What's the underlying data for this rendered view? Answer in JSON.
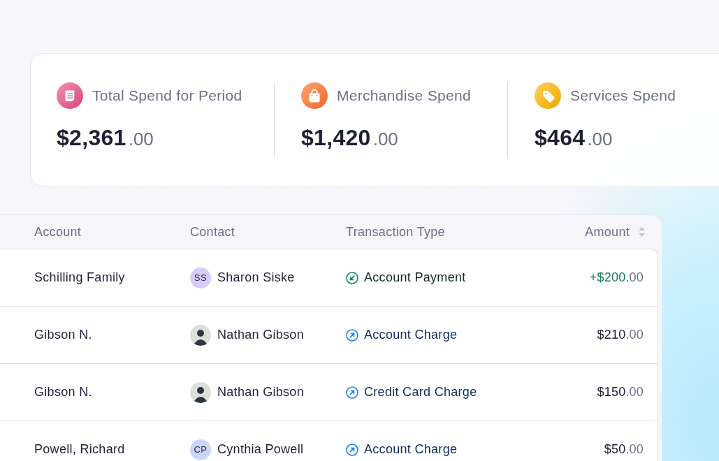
{
  "summary": {
    "stats": [
      {
        "kind": "receipt",
        "label": "Total Spend for Period",
        "amount": "$2,361",
        "cents": ".00"
      },
      {
        "kind": "bag",
        "label": "Merchandise Spend",
        "amount": "$1,420",
        "cents": ".00"
      },
      {
        "kind": "tag",
        "label": "Services Spend",
        "amount": "$464",
        "cents": ".00"
      }
    ]
  },
  "table": {
    "columns": [
      {
        "label": "Account",
        "sortable": false
      },
      {
        "label": "Contact",
        "sortable": false
      },
      {
        "label": "Transaction Type",
        "sortable": false
      },
      {
        "label": "Amount",
        "sortable": true
      }
    ],
    "rows": [
      {
        "account": "Schilling Family",
        "contact": {
          "name": "Sharon Siske",
          "avatar": {
            "kind": "initials",
            "initials": "SS",
            "color": "#d8cbfa"
          }
        },
        "type": {
          "kind": "payment",
          "label": "Account Payment"
        },
        "amount": {
          "whole": "+$200",
          "cents": ".00"
        }
      },
      {
        "account": "Gibson N.",
        "contact": {
          "name": "Nathan Gibson",
          "avatar": {
            "kind": "photo"
          }
        },
        "type": {
          "kind": "charge",
          "label": "Account Charge"
        },
        "amount": {
          "whole": "$210",
          "cents": ".00"
        }
      },
      {
        "account": "Gibson N.",
        "contact": {
          "name": "Nathan Gibson",
          "avatar": {
            "kind": "photo"
          }
        },
        "type": {
          "kind": "charge",
          "label": "Credit Card Charge"
        },
        "amount": {
          "whole": "$150",
          "cents": ".00"
        }
      },
      {
        "account": "Powell, Richard",
        "contact": {
          "name": "Cynthia Powell",
          "avatar": {
            "kind": "initials",
            "initials": "CP",
            "color": "#cad6fa"
          }
        },
        "type": {
          "kind": "charge",
          "label": "Account Charge"
        },
        "amount": {
          "whole": "$50",
          "cents": ".00"
        }
      }
    ]
  }
}
